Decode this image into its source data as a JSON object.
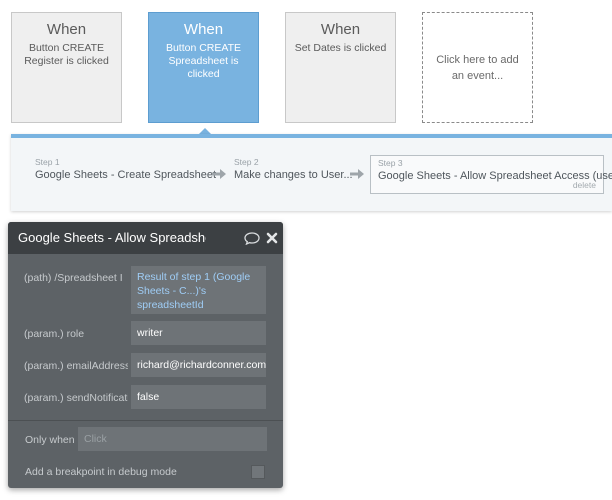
{
  "events": [
    {
      "when": "When",
      "desc": "Button CREATE Register is clicked"
    },
    {
      "when": "When",
      "desc": "Button CREATE Spreadsheet is clicked"
    },
    {
      "when": "When",
      "desc": "Set Dates is clicked"
    },
    {
      "desc": "Click here to add an event..."
    }
  ],
  "steps": [
    {
      "num": "Step 1",
      "title": "Google Sheets - Create Spreadsheet"
    },
    {
      "num": "Step 2",
      "title": "Make changes to User..."
    },
    {
      "num": "Step 3",
      "title": "Google Sheets - Allow Spreadsheet Access (user)",
      "delete": "delete"
    }
  ],
  "panel": {
    "title": "Google Sheets - Allow Spreadsheet Access (user)",
    "fields": [
      {
        "label": "(path) /Spreadsheet I",
        "value": "Result of step 1 (Google Sheets - C...)'s spreadsheetId"
      },
      {
        "label": "(param.) role",
        "value": "writer"
      },
      {
        "label": "(param.) emailAddress",
        "value": "richard@richardconner.com"
      },
      {
        "label": "(param.) sendNotificationEmail",
        "value": "false"
      }
    ],
    "only_when_label": "Only when",
    "only_when_placeholder": "Click",
    "breakpoint_label": "Add a breakpoint in debug mode"
  },
  "colors": {
    "accent": "#79b3e0",
    "panel": "#5d6266",
    "panel_header": "#3c4043",
    "dynamic_text": "#9fcdf6"
  }
}
